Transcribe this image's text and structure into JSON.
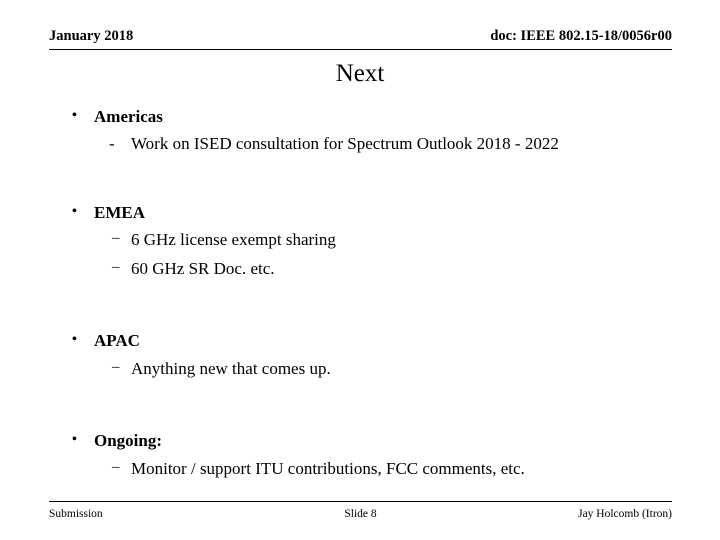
{
  "header": {
    "left": "January 2018",
    "right": "doc: IEEE 802.15-18/0056r00"
  },
  "title": "Next",
  "content": [
    {
      "label": "Americas",
      "bullet": "•",
      "subitems": [
        {
          "bullet": "-",
          "text": "Work on ISED consultation for Spectrum Outlook 2018 - 2022"
        }
      ]
    },
    {
      "label": "EMEA",
      "bullet": "•",
      "subitems": [
        {
          "bullet": "–",
          "text": "6 GHz license exempt sharing"
        },
        {
          "bullet": "–",
          "text": "60 GHz  SR Doc. etc."
        }
      ]
    },
    {
      "label": "APAC",
      "bullet": "•",
      "subitems": [
        {
          "bullet": "–",
          "text": "Anything new that comes up."
        }
      ]
    },
    {
      "label": "Ongoing:",
      "bullet": "•",
      "subitems": [
        {
          "bullet": "–",
          "text": "Monitor / support ITU contributions, FCC comments, etc."
        }
      ]
    }
  ],
  "footer": {
    "left": "Submission",
    "center": "Slide 8",
    "right": "Jay Holcomb (Itron)"
  }
}
